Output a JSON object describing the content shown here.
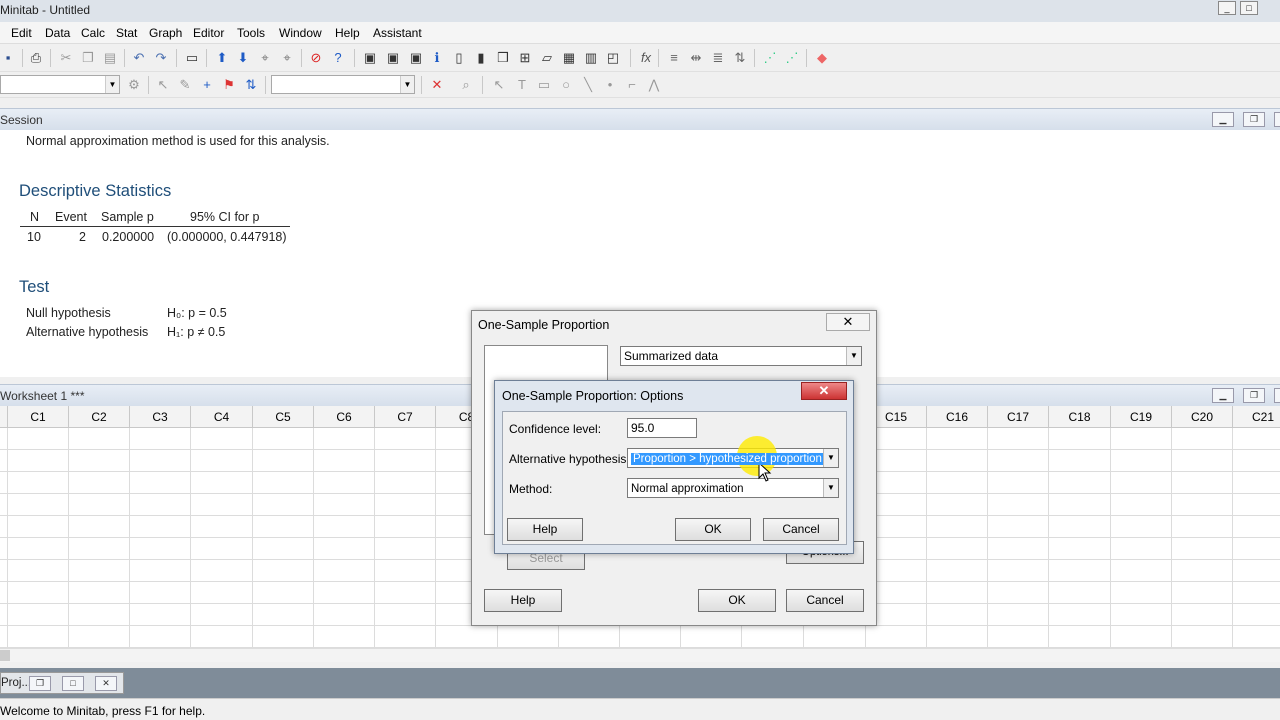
{
  "window": {
    "title": "Minitab - Untitled"
  },
  "menu": [
    "Edit",
    "Data",
    "Calc",
    "Stat",
    "Graph",
    "Editor",
    "Tools",
    "Window",
    "Help",
    "Assistant"
  ],
  "session": {
    "header": "Session",
    "note": "Normal approximation method is used for this analysis.",
    "desc_title": "Descriptive Statistics",
    "desc_columns": [
      "N",
      "Event",
      "Sample p",
      "95% CI for p"
    ],
    "desc_row": [
      "10",
      "2",
      "0.200000",
      "(0.000000, 0.447918)"
    ],
    "test_title": "Test",
    "null_label": "Null hypothesis",
    "null_value": "H₀: p = 0.5",
    "alt_label": "Alternative hypothesis",
    "alt_value": "H₁: p ≠ 0.5"
  },
  "worksheet": {
    "header": "Worksheet 1 ***",
    "columns_left": [
      "C1",
      "C2",
      "C3",
      "C4",
      "C5",
      "C6",
      "C7",
      "C8"
    ],
    "columns_right": [
      "C15",
      "C16",
      "C17",
      "C18",
      "C19",
      "C20",
      "C21"
    ]
  },
  "project_bar": {
    "label": "Proj..."
  },
  "status": {
    "text": "Welcome to Minitab, press F1 for help."
  },
  "dialog_main": {
    "title": "One-Sample Proportion",
    "data_select": "Summarized data",
    "select_button": "Select",
    "options_button": "Options...",
    "help_button": "Help",
    "ok_button": "OK",
    "cancel_button": "Cancel"
  },
  "dialog_options": {
    "title": "One-Sample Proportion: Options",
    "confidence_label": "Confidence level:",
    "confidence_value": "95.0",
    "alt_label": "Alternative hypothesis:",
    "alt_value": "Proportion > hypothesized proportion",
    "method_label": "Method:",
    "method_value": "Normal approximation",
    "help_button": "Help",
    "ok_button": "OK",
    "cancel_button": "Cancel"
  },
  "colors": {
    "highlight": "#3399ff",
    "cursor_halo": "#ffeb00",
    "heading": "#1f4e79"
  }
}
